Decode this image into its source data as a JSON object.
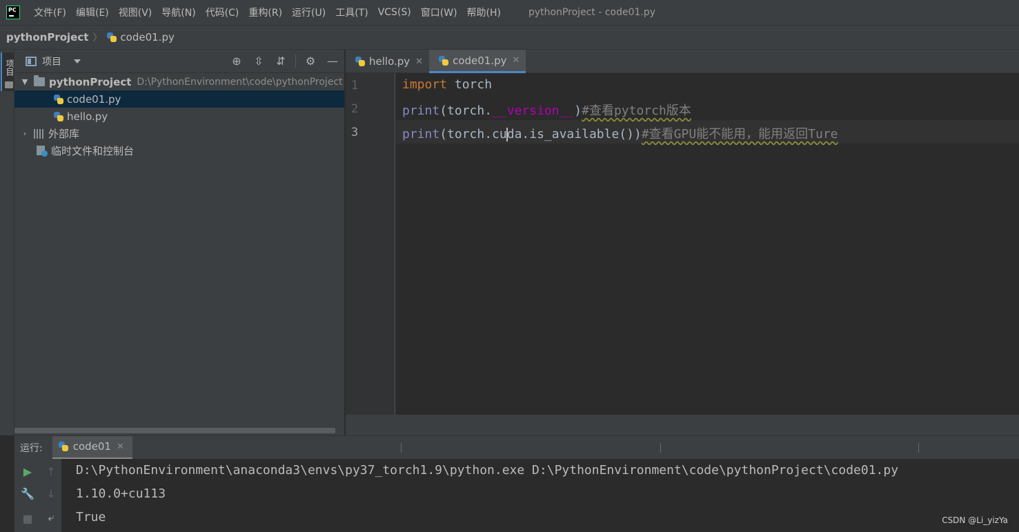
{
  "window": {
    "title": "pythonProject - code01.py"
  },
  "menu": [
    "文件(F)",
    "编辑(E)",
    "视图(V)",
    "导航(N)",
    "代码(C)",
    "重构(R)",
    "运行(U)",
    "工具(T)",
    "VCS(S)",
    "窗口(W)",
    "帮助(H)"
  ],
  "breadcrumb": {
    "project": "pythonProject",
    "separator": "〉",
    "file": "code01.py"
  },
  "left_strip": {
    "label": "项目"
  },
  "project_panel": {
    "title": "项目",
    "tree": {
      "root_name": "pythonProject",
      "root_path": "D:\\PythonEnvironment\\code\\pythonProject",
      "files": [
        "code01.py",
        "hello.py"
      ],
      "external_libs": "外部库",
      "scratches": "临时文件和控制台"
    }
  },
  "editor": {
    "tabs": [
      {
        "label": "hello.py",
        "close": "✕"
      },
      {
        "label": "code01.py",
        "close": "✕"
      }
    ],
    "line_numbers": [
      "1",
      "2",
      "3"
    ],
    "code": {
      "line1": {
        "keyword": "import",
        "rest": " torch"
      },
      "line2": {
        "func": "print",
        "open": "(torch.",
        "magic": "__version__",
        "close": ")",
        "comment": "#查看pytorch版本"
      },
      "line3": {
        "func": "print",
        "before_caret": "(torch.cu",
        "after_caret": "da.is_available())",
        "comment": "#查看GPU能不能用，能用返回Ture"
      }
    }
  },
  "run_panel": {
    "label": "运行:",
    "tab": {
      "label": "code01",
      "close": "✕"
    },
    "output": [
      "D:\\PythonEnvironment\\anaconda3\\envs\\py37_torch1.9\\python.exe D:\\PythonEnvironment\\code\\pythonProject\\code01.py",
      "1.10.0+cu113",
      "True"
    ]
  },
  "watermark": "CSDN @Li_yizYa",
  "colors": {
    "accent": "#4a88c7",
    "keyword": "#cc7832",
    "builtin": "#8888c6",
    "magic": "#b200b2",
    "comment": "#808080",
    "selection": "#0d293e"
  }
}
